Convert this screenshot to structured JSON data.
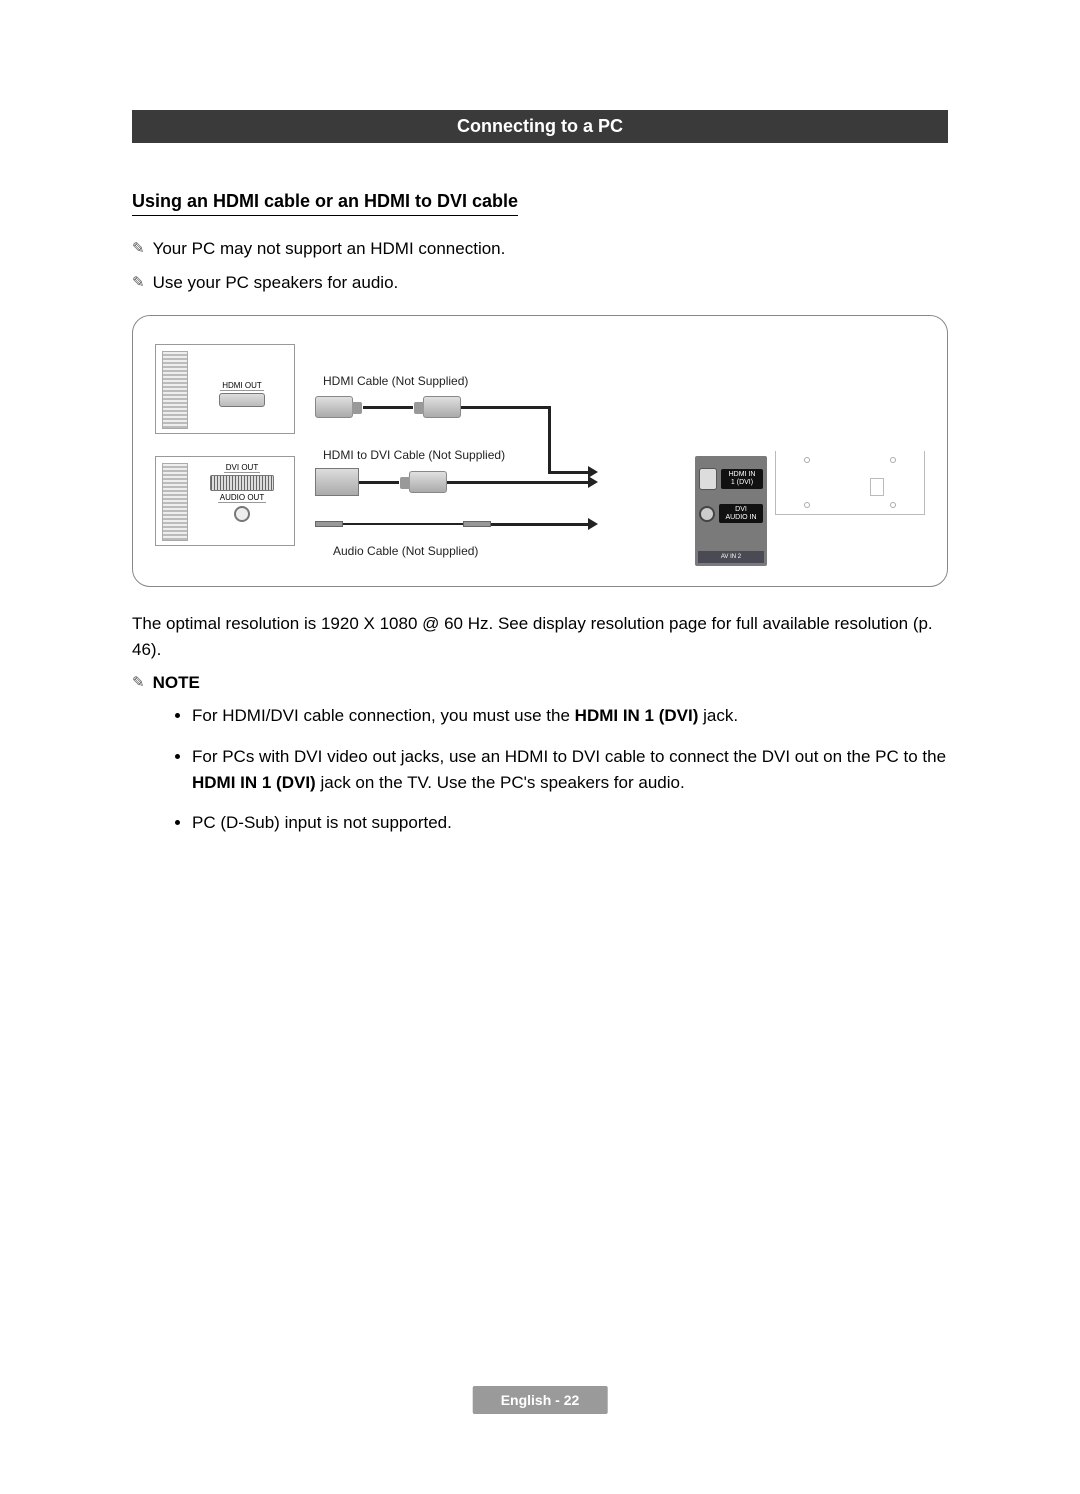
{
  "header": {
    "title": "Connecting to a PC"
  },
  "subheading": "Using an HDMI cable or an HDMI to DVI cable",
  "intro_notes": [
    "Your PC may not support an HDMI connection.",
    "Use your PC speakers for audio."
  ],
  "diagram": {
    "pc_ports": {
      "hdmi_out": "HDMI OUT",
      "dvi_out": "DVI OUT",
      "audio_out": "AUDIO OUT"
    },
    "cable_labels": {
      "hdmi": "HDMI Cable (Not Supplied)",
      "hdmi_dvi": "HDMI to DVI Cable (Not Supplied)",
      "audio": "Audio Cable (Not Supplied)"
    },
    "tv_ports": {
      "hdmi_in": "HDMI IN\n1 (DVI)",
      "dvi_audio": "DVI\nAUDIO IN",
      "av_in": "AV IN 2"
    }
  },
  "resolution_text": "The optimal resolution is 1920 X 1080 @ 60 Hz. See display resolution page for full available resolution (p. 46).",
  "note_heading": "NOTE",
  "note_bullets": [
    {
      "pre": "For HDMI/DVI cable connection, you must use the ",
      "bold": "HDMI IN 1 (DVI)",
      "post": " jack."
    },
    {
      "pre": "For PCs with DVI video out jacks, use an HDMI to DVI cable to connect the DVI out on the PC to the ",
      "bold": "HDMI IN 1 (DVI)",
      "post": " jack on the TV. Use the PC's speakers for audio."
    },
    {
      "pre": "PC (D-Sub) input is not supported.",
      "bold": "",
      "post": ""
    }
  ],
  "footer": {
    "lang": "English",
    "sep": " - ",
    "page": "22"
  }
}
